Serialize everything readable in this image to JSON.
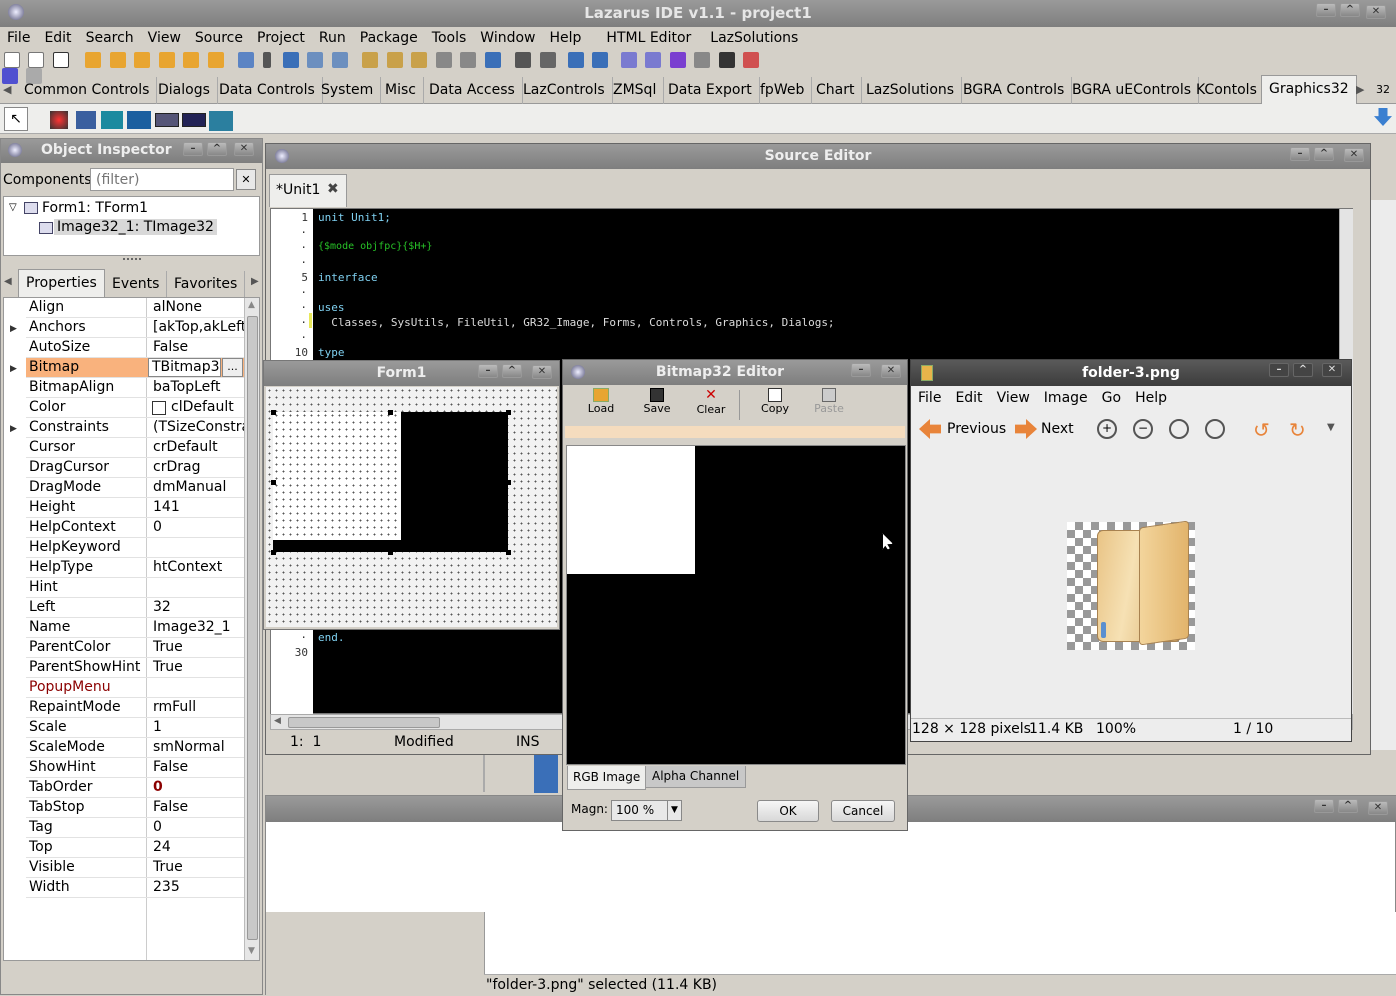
{
  "app": {
    "title": "Lazarus IDE v1.1 - project1"
  },
  "menu": [
    "File",
    "Edit",
    "Search",
    "View",
    "Source",
    "Project",
    "Run",
    "Package",
    "Tools",
    "Window",
    "Help",
    "HTML Editor",
    "LazSolutions"
  ],
  "palette_tabs": [
    "Common Controls",
    "Dialogs",
    "Data Controls",
    "System",
    "Misc",
    "Data Access",
    "LazControls",
    "ZMSql",
    "Data Export",
    "fpWeb",
    "Chart",
    "LazSolutions",
    "BGRA Controls",
    "BGRA uEControls",
    "KContols",
    "Graphics32"
  ],
  "palette_active": "Graphics32",
  "palette_side_label": "32",
  "inspector": {
    "title": "Object Inspector",
    "components_label": "Components",
    "filter_placeholder": "(filter)",
    "tree": [
      "Form1: TForm1",
      "Image32_1: TImage32"
    ],
    "tabs": [
      "Properties",
      "Events",
      "Favorites"
    ],
    "properties": [
      {
        "name": "Align",
        "value": "alNone"
      },
      {
        "name": "Anchors",
        "value": "[akTop,akLeft"
      },
      {
        "name": "AutoSize",
        "value": "False"
      },
      {
        "name": "Bitmap",
        "value": "TBitmap3"
      },
      {
        "name": "BitmapAlign",
        "value": "baTopLeft"
      },
      {
        "name": "Color",
        "value": "clDefault"
      },
      {
        "name": "Constraints",
        "value": "(TSizeConstra"
      },
      {
        "name": "Cursor",
        "value": "crDefault"
      },
      {
        "name": "DragCursor",
        "value": "crDrag"
      },
      {
        "name": "DragMode",
        "value": "dmManual"
      },
      {
        "name": "Height",
        "value": "141"
      },
      {
        "name": "HelpContext",
        "value": "0"
      },
      {
        "name": "HelpKeyword",
        "value": ""
      },
      {
        "name": "HelpType",
        "value": "htContext"
      },
      {
        "name": "Hint",
        "value": ""
      },
      {
        "name": "Left",
        "value": "32"
      },
      {
        "name": "Name",
        "value": "Image32_1"
      },
      {
        "name": "ParentColor",
        "value": "True"
      },
      {
        "name": "ParentShowHint",
        "value": "True"
      },
      {
        "name": "PopupMenu",
        "value": ""
      },
      {
        "name": "RepaintMode",
        "value": "rmFull"
      },
      {
        "name": "Scale",
        "value": "1"
      },
      {
        "name": "ScaleMode",
        "value": "smNormal"
      },
      {
        "name": "ShowHint",
        "value": "False"
      },
      {
        "name": "TabOrder",
        "value": "0"
      },
      {
        "name": "TabStop",
        "value": "False"
      },
      {
        "name": "Tag",
        "value": "0"
      },
      {
        "name": "Top",
        "value": "24"
      },
      {
        "name": "Visible",
        "value": "True"
      },
      {
        "name": "Width",
        "value": "235"
      }
    ],
    "ellipsis": "..."
  },
  "editor": {
    "title": "Source Editor",
    "tab": "*Unit1",
    "gutter": {
      "l1": "1",
      "l5": "5",
      "l10": "10",
      "l30": "30"
    },
    "lines": {
      "l1": "unit Unit1;",
      "l3": "{$mode objfpc}{$H+}",
      "l5": "interface",
      "l7": "uses",
      "l8": "  Classes, SysUtils, FileUtil, GR32_Image, Forms, Controls, Graphics, Dialogs;",
      "l10": "type",
      "end": "end."
    },
    "status": {
      "pos": "1:  1",
      "state": "Modified",
      "mode": "INS"
    }
  },
  "form1": {
    "title": "Form1"
  },
  "bitmap_editor": {
    "title": "Bitmap32 Editor",
    "tools": [
      "Load",
      "Save",
      "Clear",
      "Copy",
      "Paste"
    ],
    "tabs": [
      "RGB Image",
      "Alpha Channel"
    ],
    "magn_label": "Magn:",
    "magn_value": "100 %",
    "ok": "OK",
    "cancel": "Cancel"
  },
  "viewer": {
    "title": "folder-3.png",
    "menu": [
      "File",
      "Edit",
      "View",
      "Image",
      "Go",
      "Help"
    ],
    "prev": "Previous",
    "next": "Next",
    "status": {
      "dims": "128 × 128 pixels",
      "size": "11.4 KB",
      "zoom": "100%",
      "index": "1 / 10"
    }
  },
  "file_status": "\"folder-3.png\" selected (11.4 KB)",
  "colors": {
    "accent_highlight": "#f9b27d",
    "code_keyword": "#7fd0f0",
    "code_directive": "#27c127",
    "error_red": "#8b0000"
  }
}
